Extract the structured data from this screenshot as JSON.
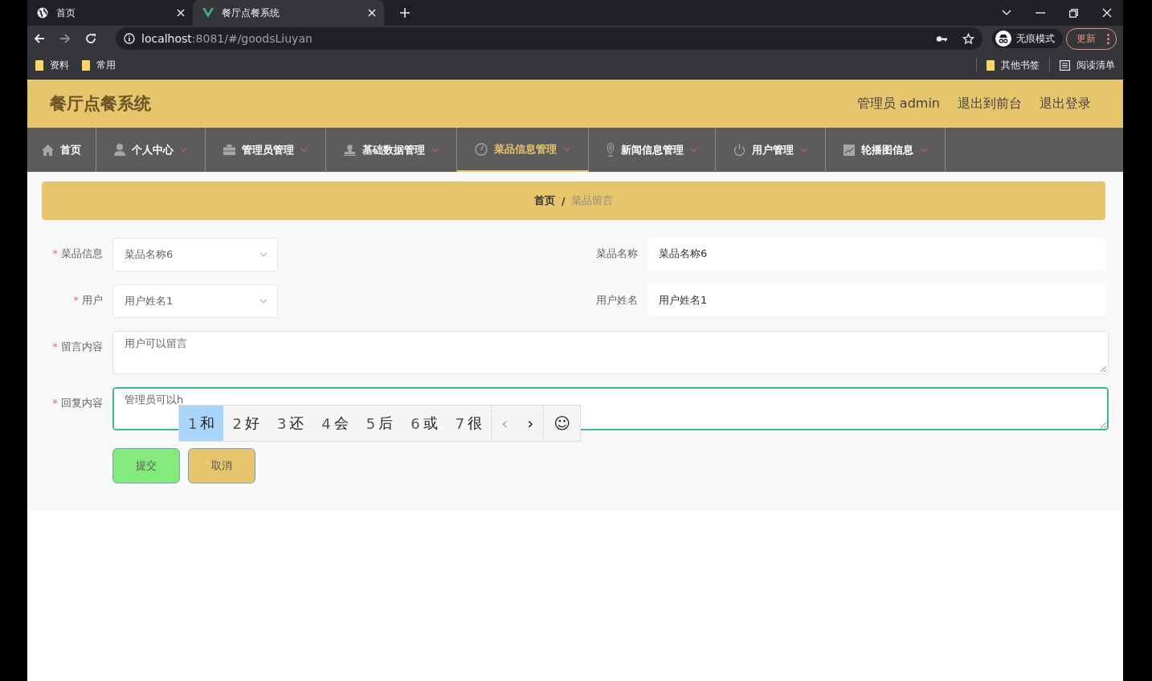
{
  "browser": {
    "tabs": [
      {
        "label": "首页",
        "selected": false
      },
      {
        "label": "餐厅点餐系统",
        "selected": true
      }
    ],
    "url": {
      "host": "localhost",
      "rest": ":8081/#/goodsLiuyan"
    },
    "bookmarks": [
      "资料",
      "常用"
    ],
    "bookmarks_right": [
      "其他书签",
      "阅读清单"
    ],
    "profile": "无痕模式",
    "update": "更新"
  },
  "app": {
    "title": "餐厅点餐系统",
    "header_links": [
      "管理员 admin",
      "退出到前台",
      "退出登录"
    ],
    "nav": [
      {
        "label": "首页",
        "selected": false,
        "dropdown": false
      },
      {
        "label": "个人中心",
        "selected": false,
        "dropdown": true
      },
      {
        "label": "管理员管理",
        "selected": false,
        "dropdown": true
      },
      {
        "label": "基础数据管理",
        "selected": false,
        "dropdown": true
      },
      {
        "label": "菜品信息管理",
        "selected": true,
        "dropdown": true
      },
      {
        "label": "新闻信息管理",
        "selected": false,
        "dropdown": true
      },
      {
        "label": "用户管理",
        "selected": false,
        "dropdown": true
      },
      {
        "label": "轮播图信息",
        "selected": false,
        "dropdown": true
      }
    ],
    "breadcrumb": {
      "separator": "/",
      "items": [
        "首页",
        "菜品留言"
      ]
    },
    "form": {
      "rows": [
        {
          "fields": [
            {
              "label": "菜品信息",
              "required_mark": "*",
              "kind": "select",
              "value": "菜品名称6"
            },
            {
              "label": "菜品名称",
              "kind": "input",
              "value": "菜品名称6"
            }
          ]
        },
        {
          "fields": [
            {
              "label": "用户",
              "required_mark": "*",
              "kind": "select",
              "value": "用户姓名1"
            },
            {
              "label": "用户姓名",
              "kind": "input",
              "value": "用户姓名1"
            }
          ]
        },
        {
          "fields": [
            {
              "label": "留言内容",
              "required_mark": "*",
              "kind": "textarea",
              "value": "用户可以留言",
              "focused": false
            }
          ]
        },
        {
          "fields": [
            {
              "label": "回复内容",
              "required_mark": "*",
              "kind": "textarea",
              "value": "管理员可以h",
              "focused": true
            }
          ]
        }
      ],
      "buttons": [
        {
          "label": "提交",
          "kind": "submit"
        },
        {
          "label": "取消",
          "kind": "cancel"
        }
      ]
    },
    "ime": {
      "candidates": [
        {
          "number": "1",
          "char": "和",
          "selected": true
        },
        {
          "number": "2",
          "char": "好",
          "selected": false
        },
        {
          "number": "3",
          "char": "还",
          "selected": false
        },
        {
          "number": "4",
          "char": "会",
          "selected": false
        },
        {
          "number": "5",
          "char": "后",
          "selected": false
        },
        {
          "number": "6",
          "char": "或",
          "selected": false
        },
        {
          "number": "7",
          "char": "很",
          "selected": false
        }
      ],
      "prev": "‹",
      "next": "›",
      "emoji": "☺"
    }
  }
}
